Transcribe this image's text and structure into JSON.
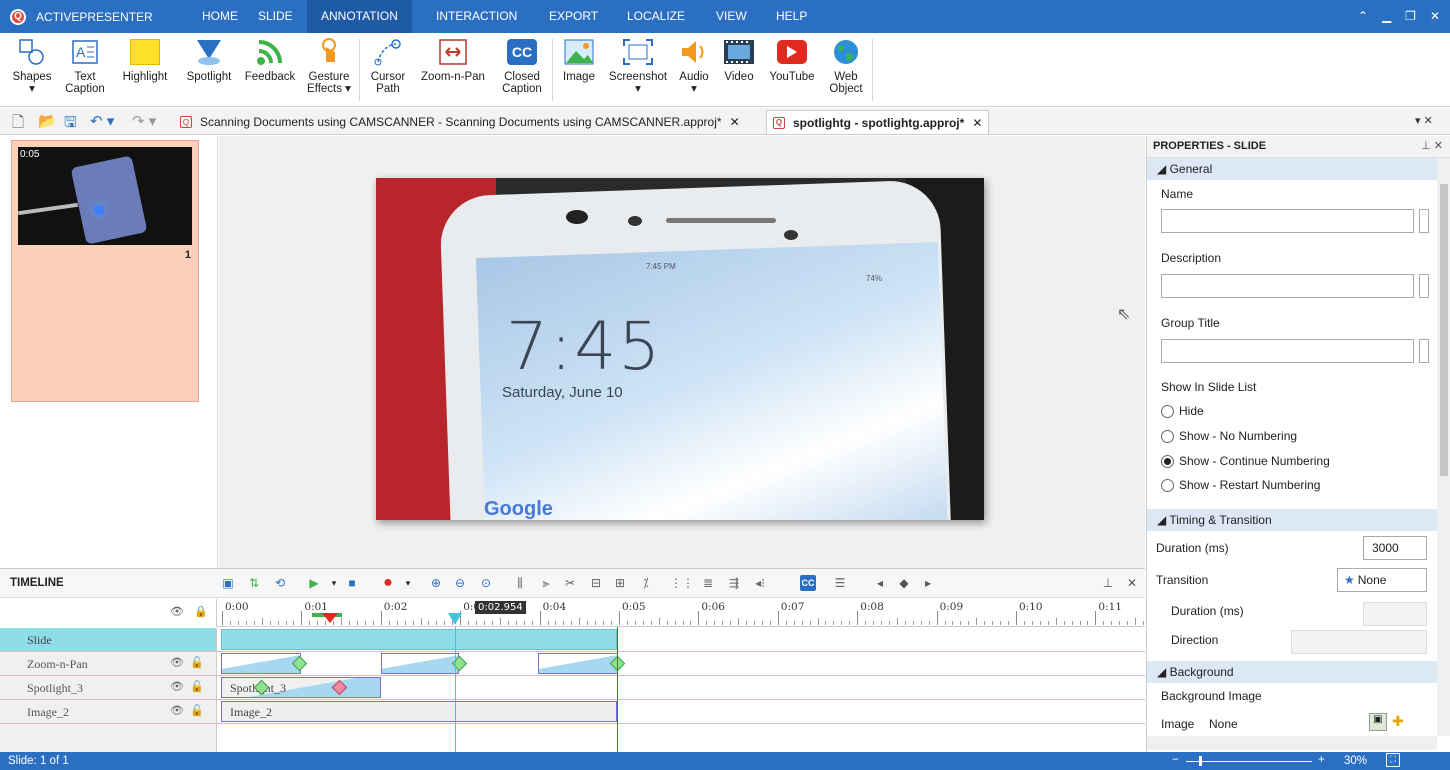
{
  "app": {
    "name": "ACTIVEPRESENTER"
  },
  "menu": {
    "tabs": [
      "HOME",
      "SLIDE",
      "ANNOTATION",
      "INTERACTION",
      "EXPORT",
      "LOCALIZE",
      "VIEW",
      "HELP"
    ],
    "active": "ANNOTATION"
  },
  "ribbon": {
    "items": [
      {
        "icon": "shapes-icon",
        "label": "Shapes",
        "label2": ""
      },
      {
        "icon": "text-caption-icon",
        "label": "Text",
        "label2": "Caption"
      },
      {
        "icon": "highlight-icon",
        "label": "Highlight",
        "label2": ""
      },
      {
        "icon": "spotlight-icon",
        "label": "Spotlight",
        "label2": ""
      },
      {
        "icon": "feedback-icon",
        "label": "Feedback",
        "label2": ""
      },
      {
        "icon": "gesture-icon",
        "label": "Gesture",
        "label2": "Effects ▾"
      },
      {
        "icon": "cursor-path-icon",
        "label": "Cursor",
        "label2": "Path"
      },
      {
        "icon": "zoom-n-pan-icon",
        "label": "Zoom-n-Pan",
        "label2": ""
      },
      {
        "icon": "closed-caption-icon",
        "label": "Closed",
        "label2": "Caption"
      },
      {
        "icon": "image-icon",
        "label": "Image",
        "label2": ""
      },
      {
        "icon": "screenshot-icon",
        "label": "Screenshot",
        "label2": ""
      },
      {
        "icon": "audio-icon",
        "label": "Audio",
        "label2": ""
      },
      {
        "icon": "video-icon",
        "label": "Video",
        "label2": ""
      },
      {
        "icon": "youtube-icon",
        "label": "YouTube",
        "label2": ""
      },
      {
        "icon": "web-object-icon",
        "label": "Web",
        "label2": "Object"
      }
    ]
  },
  "doc_tabs": [
    {
      "title": "Scanning Documents using CAMSCANNER - Scanning Documents using CAMSCANNER.approj*",
      "close": "✕",
      "active": false
    },
    {
      "title": "spotlightg - spotlightg.approj*",
      "close": "✕",
      "active": true
    }
  ],
  "slides": {
    "thumb_time": "0:05",
    "thumb_number": "1"
  },
  "video": {
    "clock": "7:45",
    "date": "Saturday, June 10",
    "status_time": "7:45 PM",
    "battery": "74%",
    "brand": "Google"
  },
  "timeline": {
    "title": "TIMELINE",
    "playhead": "0:02.954",
    "ticks": [
      "0:00",
      "0:01",
      "0:02",
      "0:03",
      "0:04",
      "0:05",
      "0:06",
      "0:07",
      "0:08",
      "0:09",
      "0:10",
      "0:11"
    ],
    "tracks": [
      {
        "name": "Slide",
        "bar_label": ""
      },
      {
        "name": "Zoom-n-Pan",
        "bar_label": ""
      },
      {
        "name": "Spotlight_3",
        "bar_label": "Spotlight_3"
      },
      {
        "name": "Image_2",
        "bar_label": "Image_2"
      }
    ]
  },
  "properties": {
    "title": "PROPERTIES - SLIDE",
    "general": "General",
    "name_label": "Name",
    "description_label": "Description",
    "group_title_label": "Group Title",
    "show_in_slide_list": "Show In Slide List",
    "options": [
      "Hide",
      "Show - No Numbering",
      "Show - Continue Numbering",
      "Show - Restart Numbering"
    ],
    "selected_option": "Show - Continue Numbering",
    "timing": "Timing & Transition",
    "duration_label": "Duration (ms)",
    "duration_value": "3000",
    "transition_label": "Transition",
    "transition_value": "None",
    "trans_duration_label": "Duration (ms)",
    "direction_label": "Direction",
    "background": "Background",
    "background_image": "Background Image",
    "image_label": "Image",
    "image_value": "None"
  },
  "status": {
    "slide": "Slide: 1 of 1",
    "zoom": "30%"
  },
  "colors": {
    "accent": "#2b6fc3",
    "accent_dark": "#1f5aa4",
    "track_bar": "#a7d8f2",
    "slide_bar": "#8fdde6",
    "keyframe_green": "#8fe08f",
    "keyframe_red": "#f08a9c"
  }
}
